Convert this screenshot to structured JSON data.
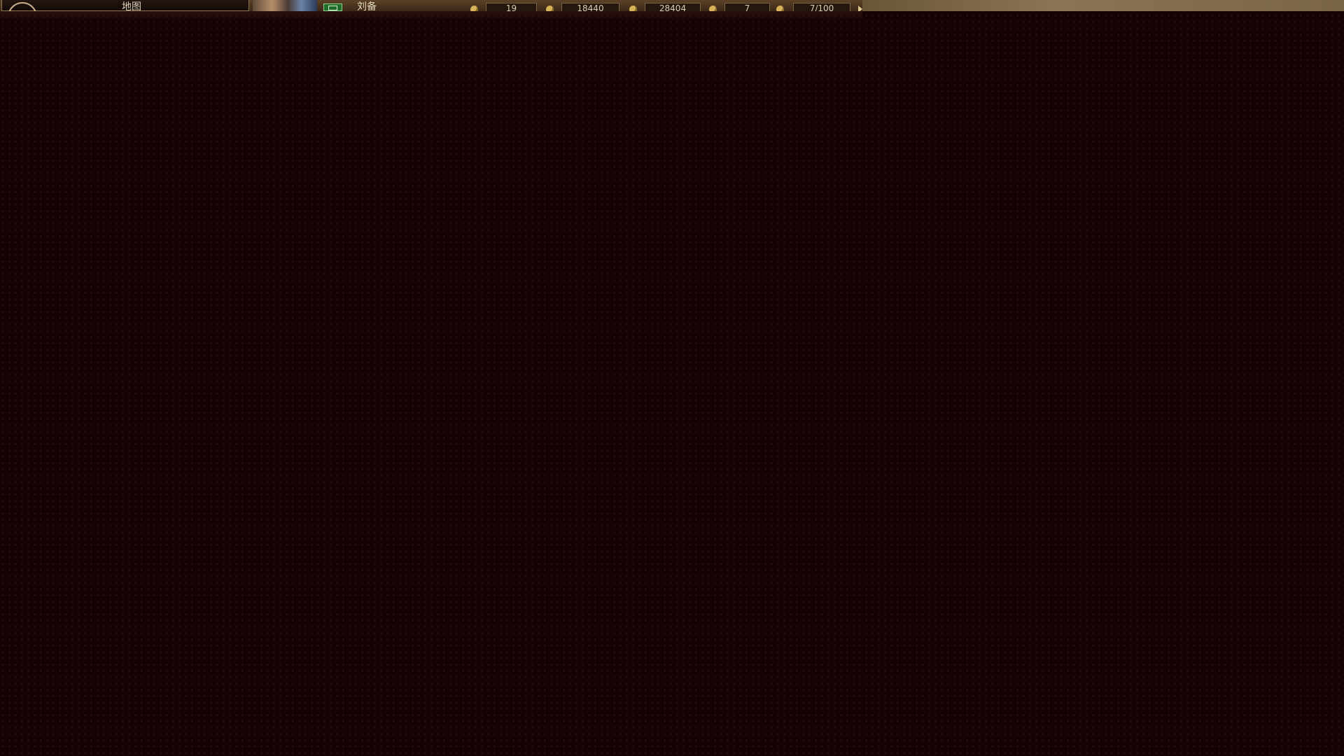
{
  "hud": {
    "location": "地图",
    "leader_name": "刘备",
    "faction_badge_icon": "faction-seal-icon",
    "resources": [
      {
        "icon": "troops-icon",
        "value": "19"
      },
      {
        "icon": "gold-icon",
        "value": "18440"
      },
      {
        "icon": "food-icon",
        "value": "28404"
      },
      {
        "icon": "officer-icon",
        "value": "7"
      },
      {
        "icon": "city-icon",
        "value": "7/100"
      }
    ],
    "more_icon": "expand-arrow-icon"
  },
  "colors": {
    "background": "#150304",
    "hud_bar": "#5c4128",
    "text": "#ddd0b8",
    "faction": "#1f6d2a"
  }
}
